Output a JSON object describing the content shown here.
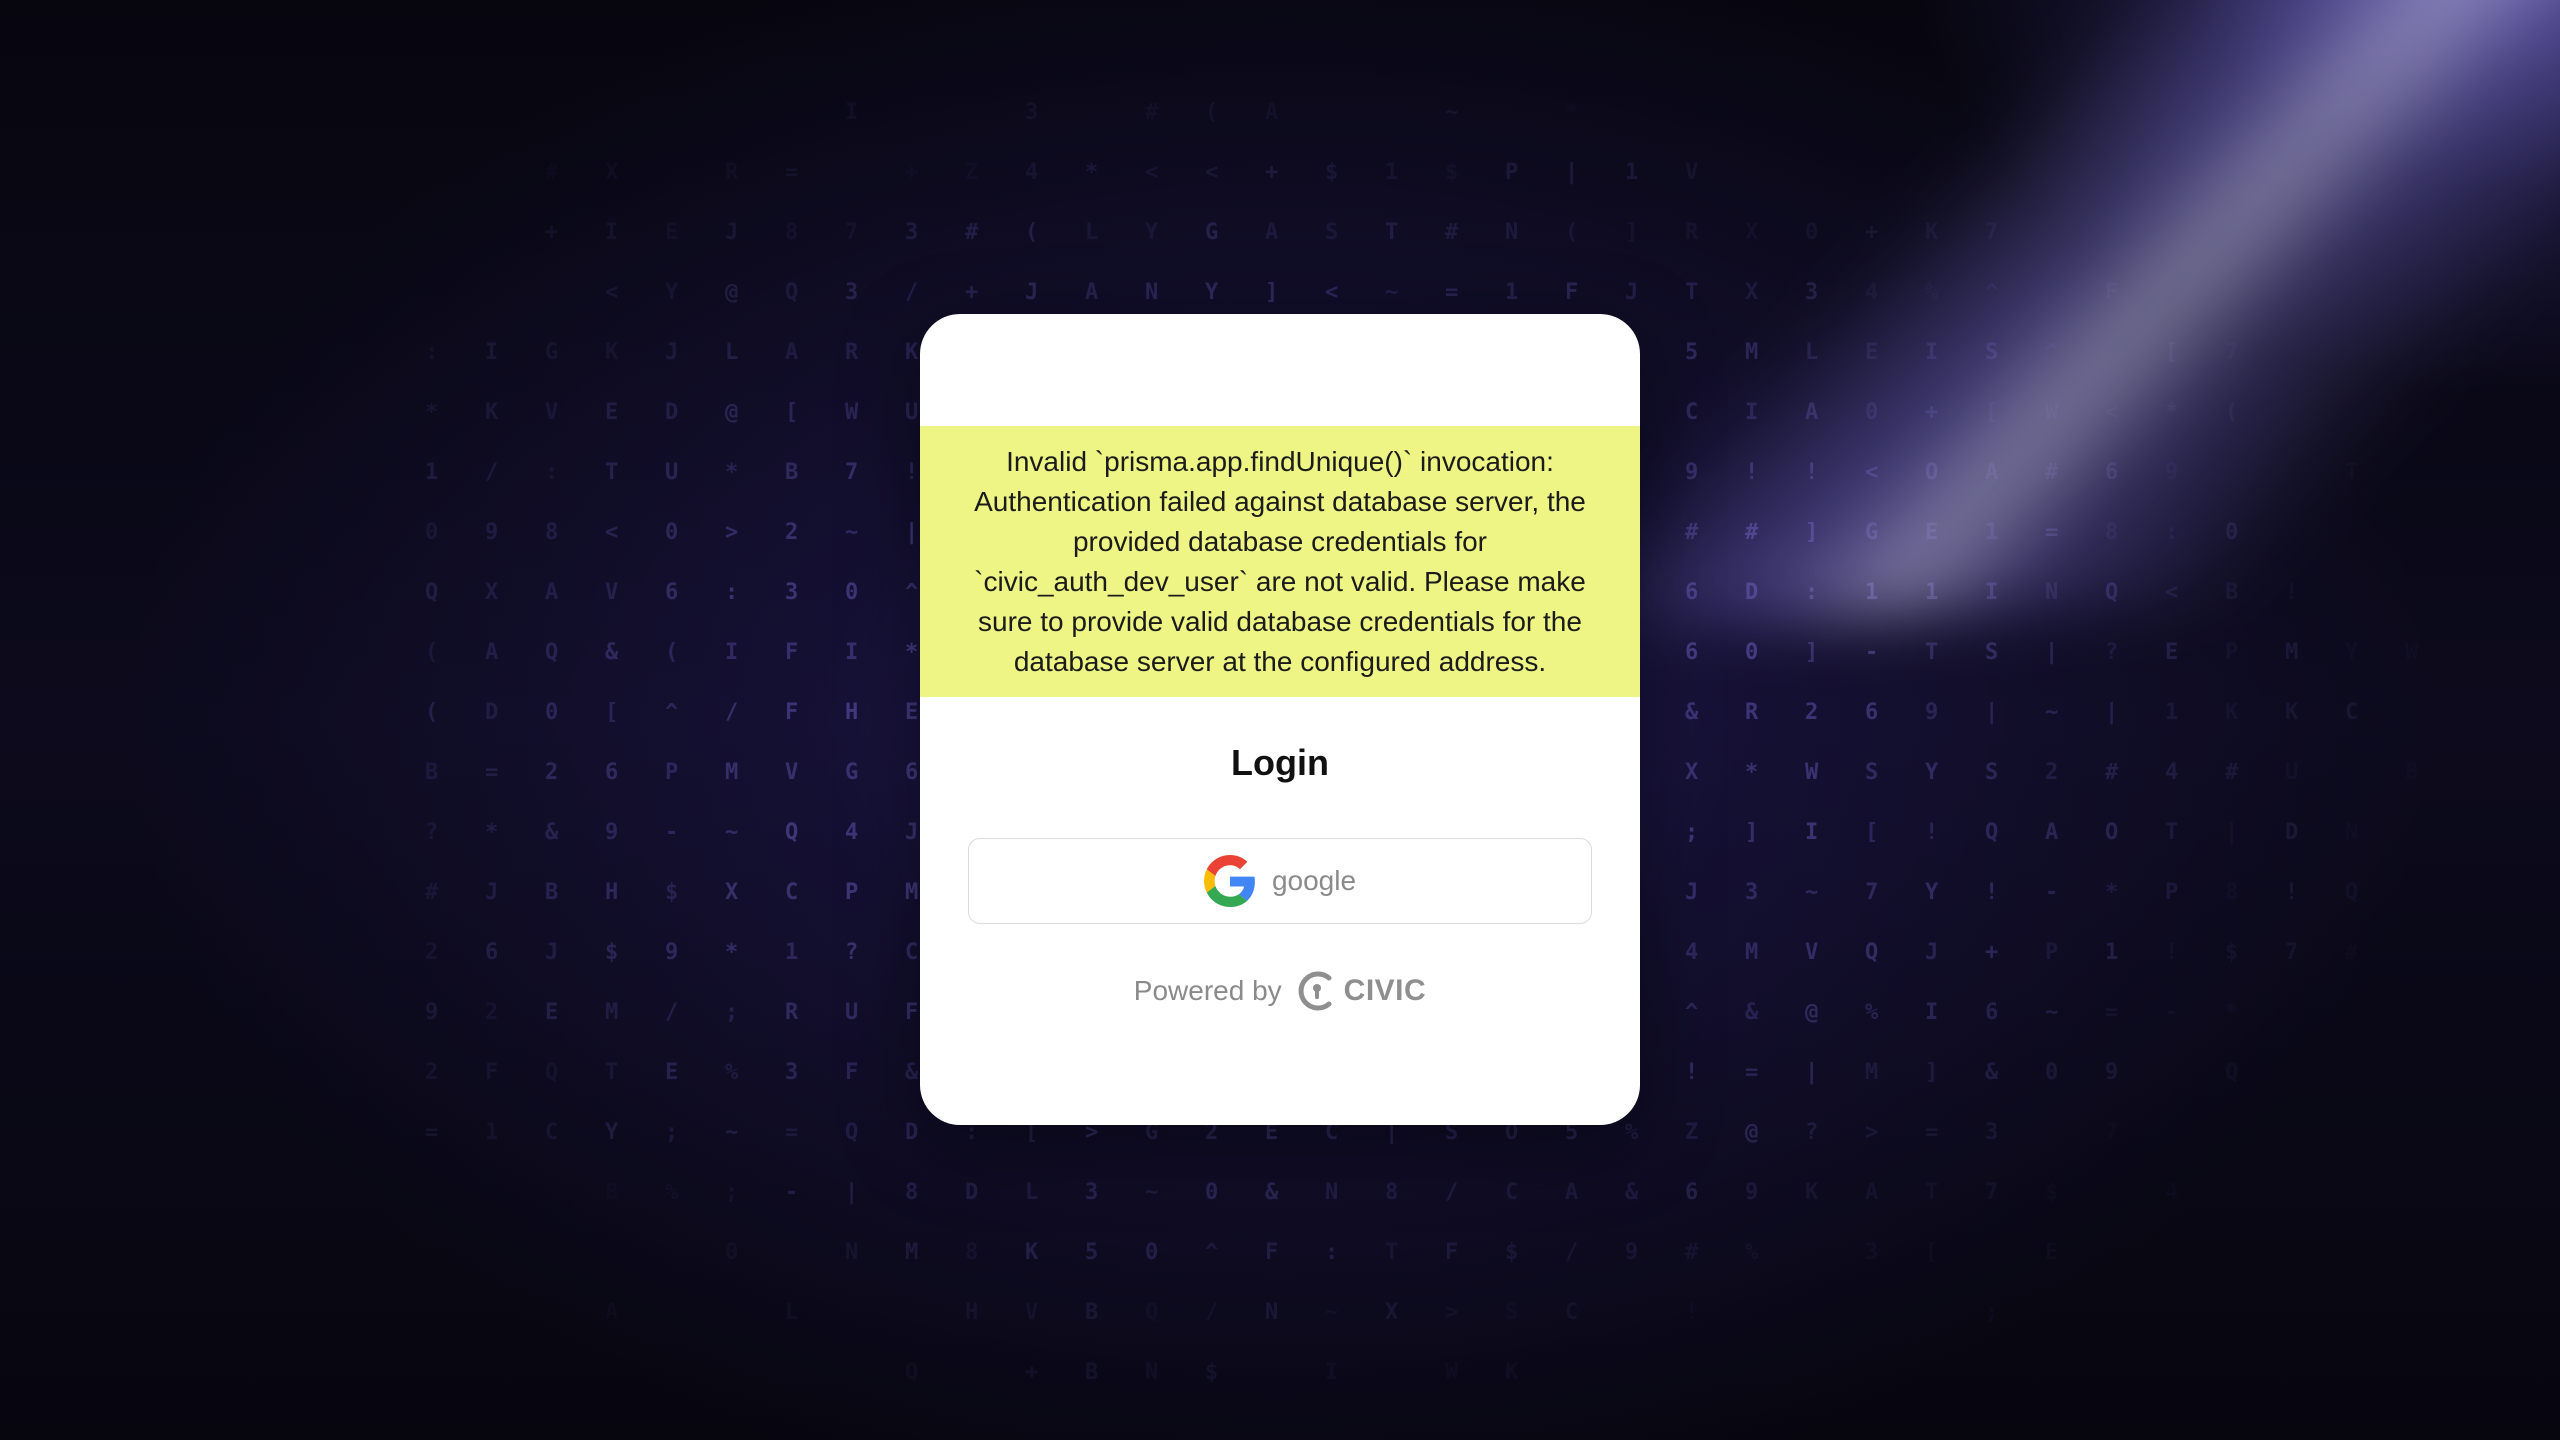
{
  "background": {
    "glyphs": [
      "0",
      "8",
      "Z",
      "T",
      "L",
      "W",
      "Q",
      "E",
      "B",
      "(",
      "&",
      "%",
      "?",
      "#",
      "!",
      "$",
      "S",
      ":",
      "^",
      "K",
      "H",
      "U",
      "5",
      "R",
      ">",
      "<",
      "+",
      "X",
      "A",
      "F",
      "@",
      "Y",
      "V",
      "C",
      "I",
      "[",
      "]",
      "=",
      "3",
      "4",
      "6",
      "7",
      "9",
      "1",
      "2",
      "N",
      "M",
      "D",
      "G",
      "P",
      "O",
      "J",
      "/",
      "|",
      ";",
      "*",
      "~",
      "-"
    ],
    "glyph_color": "#7f72e6",
    "beam_color": "#b0a8ff"
  },
  "card": {
    "error_message": "Invalid `prisma.app.findUnique()` invocation: Authentication failed against database server, the provided database credentials for `civic_auth_dev_user` are not valid. Please make sure to provide valid database credentials for the database server at the configured address.",
    "error_background": "#eef585",
    "title": "Login",
    "google_button_label": "google",
    "powered_by_label": "Powered by",
    "brand_name": "CIVIC"
  },
  "icons": {
    "google": "google-g-icon",
    "civic": "civic-logo-icon"
  }
}
